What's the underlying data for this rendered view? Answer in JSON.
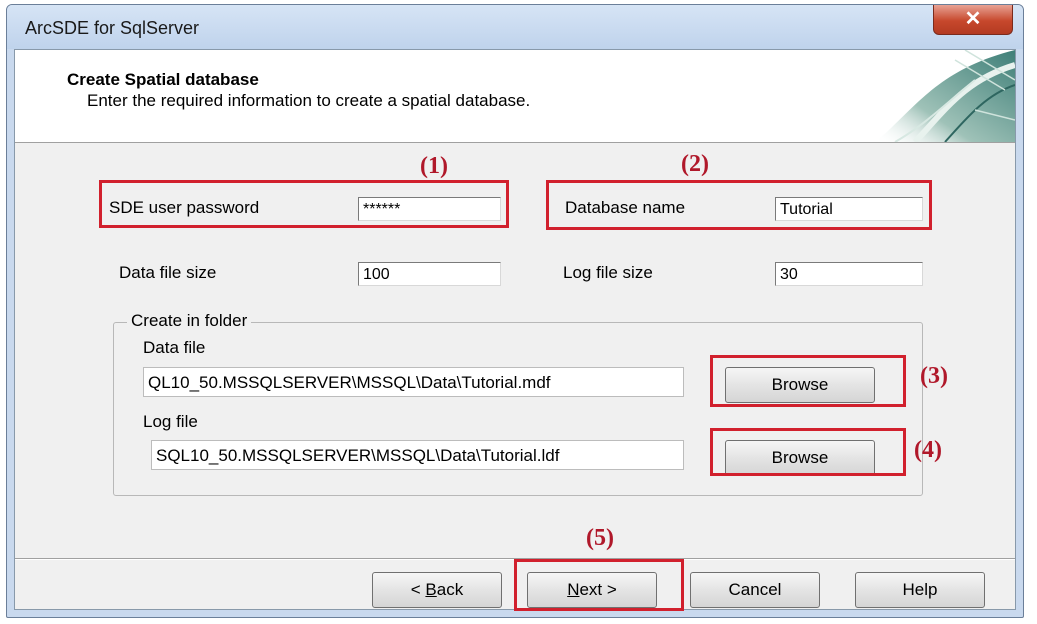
{
  "window": {
    "title": "ArcSDE for SqlServer",
    "close_glyph": "✕"
  },
  "header": {
    "title": "Create Spatial database",
    "subtitle": "Enter the required information to create a spatial database."
  },
  "form": {
    "sde_password_label": "SDE user password",
    "sde_password_value": "******",
    "database_name_label": "Database name",
    "database_name_value": "Tutorial",
    "data_file_size_label": "Data file size",
    "data_file_size_value": "100",
    "log_file_size_label": "Log file size",
    "log_file_size_value": "30"
  },
  "folder": {
    "legend": "Create in folder",
    "data_file_label": "Data file",
    "data_file_path": "QL10_50.MSSQLSERVER\\MSSQL\\Data\\Tutorial.mdf",
    "log_file_label": "Log file",
    "log_file_path": "SQL10_50.MSSQLSERVER\\MSSQL\\Data\\Tutorial.ldf",
    "browse_label": "Browse"
  },
  "footer": {
    "back_prefix": "< ",
    "back_mnemonic": "B",
    "back_rest": "ack",
    "next_mnemonic": "N",
    "next_rest": "ext >",
    "cancel_label": "Cancel",
    "help_label": "Help"
  },
  "annotations": [
    "(1)",
    "(2)",
    "(3)",
    "(4)",
    "(5)"
  ],
  "colors": {
    "annotation_red": "#d1202d",
    "titlebar": "#c9d9ee",
    "close_button": "#c7482c"
  }
}
